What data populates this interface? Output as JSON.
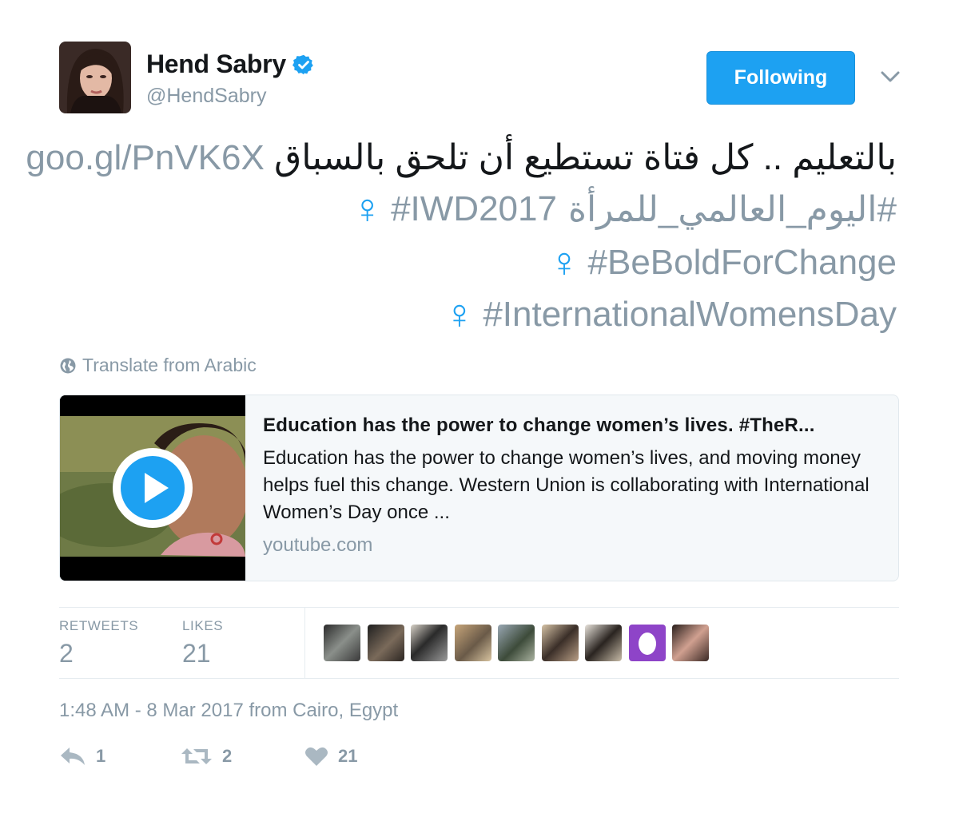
{
  "user": {
    "display_name": "Hend Sabry",
    "handle": "@HendSabry",
    "verified": true
  },
  "follow_button": {
    "label": "Following"
  },
  "tweet": {
    "line1_arabic": "بالتعليم .. كل فتاة تستطيع أن تلحق بالسباق",
    "line1_link": "goo.gl/PnVK6X",
    "hashtag_arabic": "#اليوم_العالمي_للمرأة",
    "female_sign": "♀",
    "hashtag_iwd": "#IWD2017",
    "hashtag_bebold": "#BeBoldForChange",
    "hashtag_iwd_full": "#InternationalWomensDay"
  },
  "translate_label": "Translate from Arabic",
  "card": {
    "title": "Education has the power to change women’s lives. #TheR...",
    "description": "Education has the power to change women’s lives, and moving money helps fuel this change. Western Union is collaborating with International Women’s Day once ...",
    "domain": "youtube.com"
  },
  "stats": {
    "retweets_label": "RETWEETS",
    "retweets_value": "2",
    "likes_label": "LIKES",
    "likes_value": "21"
  },
  "timestamp": {
    "time_date": "1:48 AM - 8 Mar 2017 from ",
    "place": "Cairo, Egypt"
  },
  "actions": {
    "reply_count": "1",
    "retweet_count": "2",
    "like_count": "21"
  },
  "colors": {
    "accent": "#1da1f2",
    "muted": "#8899a6",
    "text": "#14171a"
  },
  "icons": [
    "verified-badge-icon",
    "chevron-down-icon",
    "globe-icon",
    "play-icon",
    "reply-icon",
    "retweet-icon",
    "heart-icon"
  ]
}
